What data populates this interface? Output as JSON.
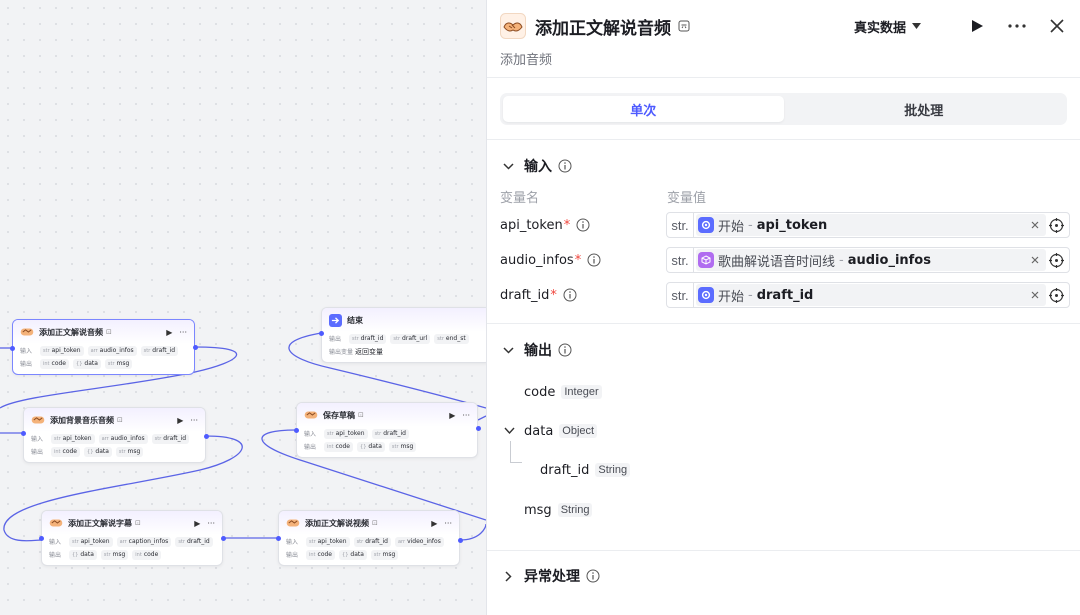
{
  "canvas": {
    "nodes": [
      {
        "id": "n1",
        "title": "添加正文解说音频",
        "input_label": "输入",
        "output_label": "输出",
        "inputs": [
          {
            "t": "str",
            "n": "api_token"
          },
          {
            "t": "arr",
            "n": "audio_infos"
          },
          {
            "t": "str",
            "n": "draft_id"
          }
        ],
        "outputs": [
          {
            "t": "int",
            "n": "code"
          },
          {
            "t": "{}",
            "n": "data"
          },
          {
            "t": "str",
            "n": "msg"
          }
        ]
      },
      {
        "id": "n2",
        "title": "添加背景音乐音频",
        "input_label": "输入",
        "output_label": "输出",
        "inputs": [
          {
            "t": "str",
            "n": "api_token"
          },
          {
            "t": "arr",
            "n": "audio_infos"
          },
          {
            "t": "str",
            "n": "draft_id"
          }
        ],
        "outputs": [
          {
            "t": "int",
            "n": "code"
          },
          {
            "t": "{}",
            "n": "data"
          },
          {
            "t": "str",
            "n": "msg"
          }
        ]
      },
      {
        "id": "n3",
        "title": "添加正文解说字幕",
        "input_label": "输入",
        "output_label": "输出",
        "inputs": [
          {
            "t": "str",
            "n": "api_token"
          },
          {
            "t": "arr",
            "n": "caption_infos"
          },
          {
            "t": "str",
            "n": "draft_id"
          }
        ],
        "outputs": [
          {
            "t": "{}",
            "n": "data"
          },
          {
            "t": "str",
            "n": "msg"
          },
          {
            "t": "int",
            "n": "code"
          }
        ]
      },
      {
        "id": "n4",
        "title": "添加正文解说视频",
        "input_label": "输入",
        "output_label": "输出",
        "inputs": [
          {
            "t": "str",
            "n": "api_token"
          },
          {
            "t": "str",
            "n": "draft_id"
          },
          {
            "t": "arr",
            "n": "video_infos"
          }
        ],
        "outputs": [
          {
            "t": "int",
            "n": "code"
          },
          {
            "t": "{}",
            "n": "data"
          },
          {
            "t": "str",
            "n": "msg"
          }
        ]
      },
      {
        "id": "n5",
        "title": "保存草稿",
        "input_label": "输入",
        "output_label": "输出",
        "inputs": [
          {
            "t": "str",
            "n": "api_token"
          },
          {
            "t": "str",
            "n": "draft_id"
          }
        ],
        "outputs": [
          {
            "t": "int",
            "n": "code"
          },
          {
            "t": "{}",
            "n": "data"
          },
          {
            "t": "str",
            "n": "msg"
          }
        ]
      },
      {
        "id": "n6",
        "title": "结束",
        "input_label": "输出",
        "output_label": "输出变量",
        "inputs": [
          {
            "t": "str",
            "n": "draft_id"
          },
          {
            "t": "str",
            "n": "draft_url"
          },
          {
            "t": "str",
            "n": "end_st"
          }
        ],
        "output_text": "返回变量"
      }
    ]
  },
  "panel": {
    "title": "添加正文解说音频",
    "subtitle": "添加音频",
    "data_select": "真实数据",
    "tabs": [
      "单次",
      "批处理"
    ],
    "input_section": "输入",
    "col_name": "变量名",
    "col_value": "变量值",
    "inputs": [
      {
        "name": "api_token",
        "type": "str.",
        "ref_node": "开始",
        "ref_var": "api_token",
        "ref_color": "#5b6cff"
      },
      {
        "name": "audio_infos",
        "type": "str.",
        "ref_node": "歌曲解说语音时间线",
        "ref_var": "audio_infos",
        "ref_color": "#b06cf0"
      },
      {
        "name": "draft_id",
        "type": "str.",
        "ref_node": "开始",
        "ref_var": "draft_id",
        "ref_color": "#5b6cff"
      }
    ],
    "separator": "-",
    "output_section": "输出",
    "outputs": {
      "code": {
        "name": "code",
        "type": "Integer"
      },
      "data": {
        "name": "data",
        "type": "Object"
      },
      "draft_id": {
        "name": "draft_id",
        "type": "String"
      },
      "msg": {
        "name": "msg",
        "type": "String"
      }
    },
    "error_section": "异常处理"
  }
}
